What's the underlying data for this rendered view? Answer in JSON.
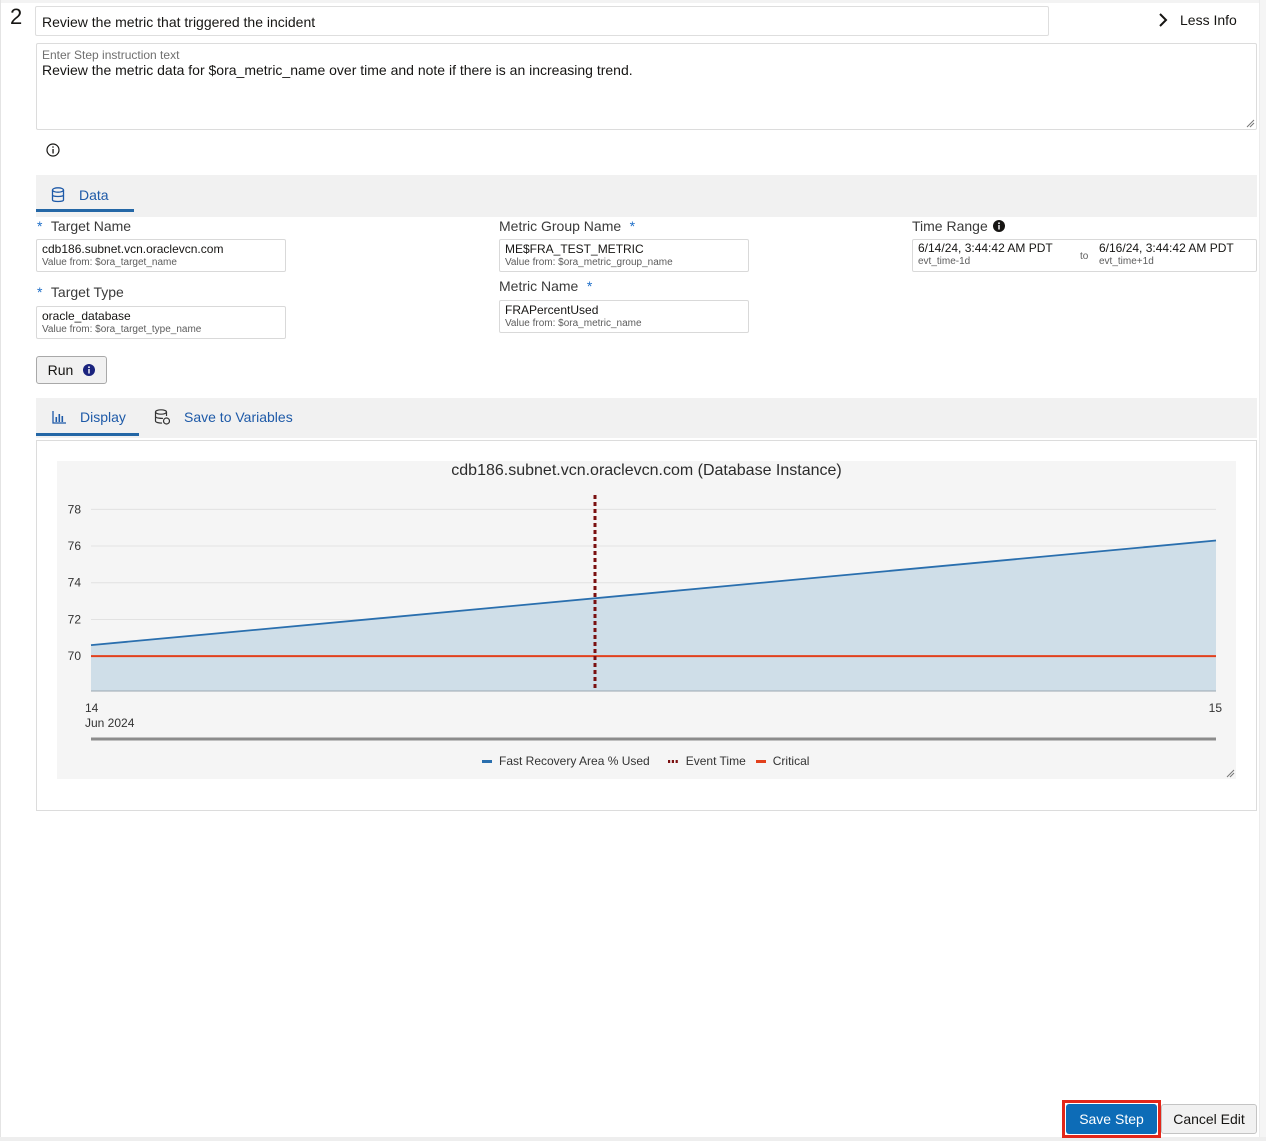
{
  "step": {
    "number": "2",
    "title": "Review the metric that triggered the incident",
    "less_info": "Less Info",
    "instruction_label": "Enter Step instruction text",
    "instruction_text": "Review the metric data for $ora_metric_name over time and note if there is an increasing trend."
  },
  "tabs": {
    "data": "Data",
    "display": "Display",
    "save_to_variables": "Save to Variables"
  },
  "fields": {
    "target_name": {
      "label": "Target Name",
      "value": "cdb186.subnet.vcn.oraclevcn.com",
      "source": "Value from: $ora_target_name"
    },
    "target_type": {
      "label": "Target Type",
      "value": "oracle_database",
      "source": "Value from: $ora_target_type_name"
    },
    "metric_group_name": {
      "label": "Metric Group Name",
      "value": "ME$FRA_TEST_METRIC",
      "source": "Value from: $ora_metric_group_name"
    },
    "metric_name": {
      "label": "Metric Name",
      "value": "FRAPercentUsed",
      "source": "Value from: $ora_metric_name"
    },
    "time_range": {
      "label": "Time Range",
      "start": "6/14/24, 3:44:42 AM PDT",
      "start_source": "evt_time-1d",
      "to": "to",
      "end": "6/16/24, 3:44:42 AM PDT",
      "end_source": "evt_time+1d"
    },
    "required_marker": "*"
  },
  "buttons": {
    "run": "Run",
    "save_step": "Save Step",
    "cancel_edit": "Cancel Edit"
  },
  "colors": {
    "accent": "#0d6cb7",
    "series": "#2a6fae",
    "area": "#cfdee8",
    "event": "#7a1010",
    "critical": "#e2401c",
    "highlight": "#e3271a"
  },
  "chart_data": {
    "type": "area",
    "title": "cdb186.subnet.vcn.oraclevcn.com (Database Instance)",
    "x_tick_labels": [
      {
        "day": "14",
        "month": "Jun 2024"
      },
      {
        "day": "15",
        "month": ""
      }
    ],
    "x": [
      "2024-06-14",
      "2024-06-15"
    ],
    "y_ticks": [
      70,
      72,
      74,
      76,
      78
    ],
    "ylim": [
      68.1,
      79
    ],
    "series": [
      {
        "name": "Fast Recovery Area % Used",
        "kind": "area",
        "values": [
          70.6,
          76.3
        ]
      },
      {
        "name": "Critical",
        "kind": "threshold",
        "values": [
          70,
          70
        ]
      }
    ],
    "event_marker": {
      "name": "Event Time",
      "x_fraction": 0.448
    },
    "legend": [
      "Fast Recovery Area % Used",
      "Event Time",
      "Critical"
    ],
    "legend_position": "bottom",
    "grid": true
  }
}
